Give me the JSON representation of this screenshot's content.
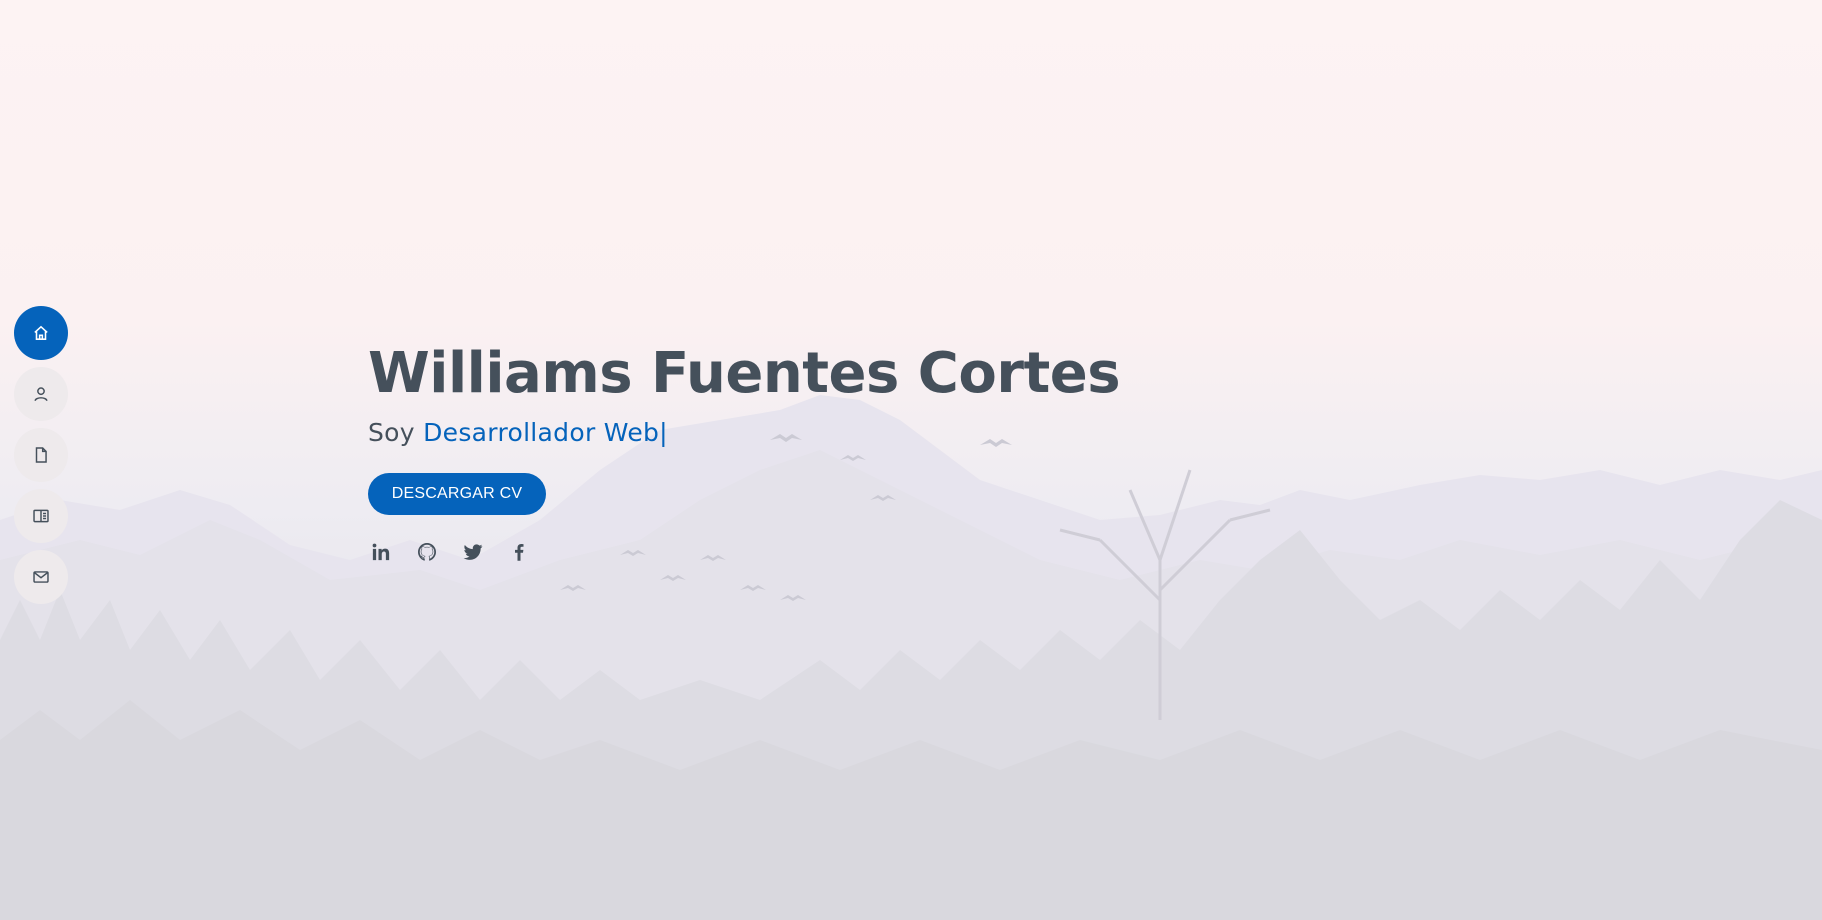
{
  "hero": {
    "name": "Williams Fuentes Cortes",
    "subtitle_prefix": "Soy",
    "subtitle_role": "Desarrollador Web|",
    "cv_button_label": "DESCARGAR CV"
  },
  "sidenav": {
    "items": [
      {
        "icon": "home-icon",
        "active": true
      },
      {
        "icon": "person-icon",
        "active": false
      },
      {
        "icon": "file-icon",
        "active": false
      },
      {
        "icon": "book-icon",
        "active": false
      },
      {
        "icon": "envelope-icon",
        "active": false
      }
    ]
  },
  "social": [
    {
      "icon": "linkedin-icon"
    },
    {
      "icon": "github-icon"
    },
    {
      "icon": "twitter-icon"
    },
    {
      "icon": "facebook-icon"
    }
  ],
  "colors": {
    "accent": "#0563bb",
    "text": "#45505b",
    "nav_bg": "#eeeaec"
  }
}
